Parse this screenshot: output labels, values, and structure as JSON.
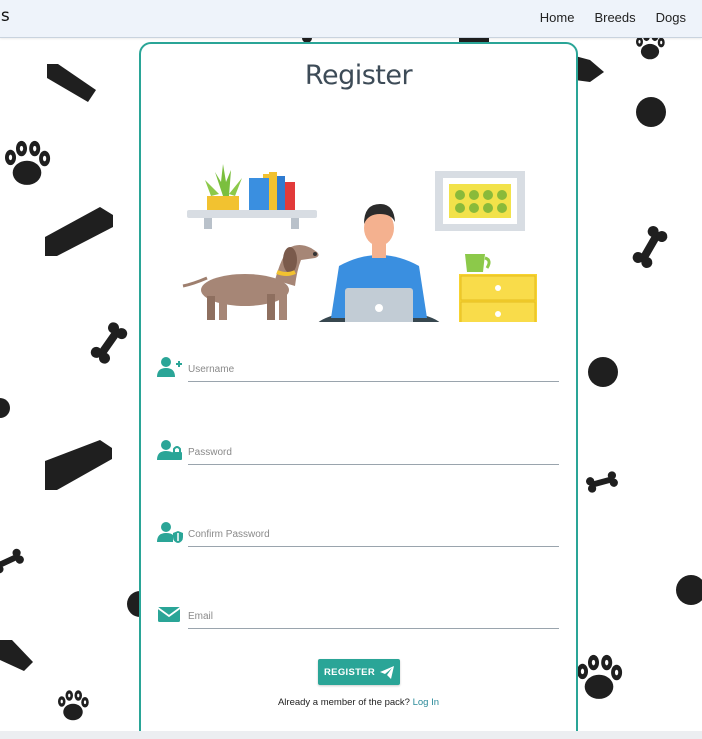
{
  "navbar": {
    "brand_fragment": "ls",
    "links": [
      "Home",
      "Breeds",
      "Dogs"
    ]
  },
  "card": {
    "title": "Register",
    "fields": [
      {
        "placeholder": "Username",
        "icon": "user-plus-icon"
      },
      {
        "placeholder": "Password",
        "icon": "user-lock-icon"
      },
      {
        "placeholder": "Confirm Password",
        "icon": "user-shield-icon"
      },
      {
        "placeholder": "Email",
        "icon": "envelope-icon"
      }
    ],
    "register_label": "REGISTER",
    "register_icon": "paper-plane-icon",
    "already_text": "Already a member of the pack?",
    "login_label": "Log In"
  },
  "colors": {
    "accent": "#2aa597",
    "navbar_bg": "#eef3fa",
    "title": "#3d4b57",
    "pattern": "#1f1f1f"
  }
}
